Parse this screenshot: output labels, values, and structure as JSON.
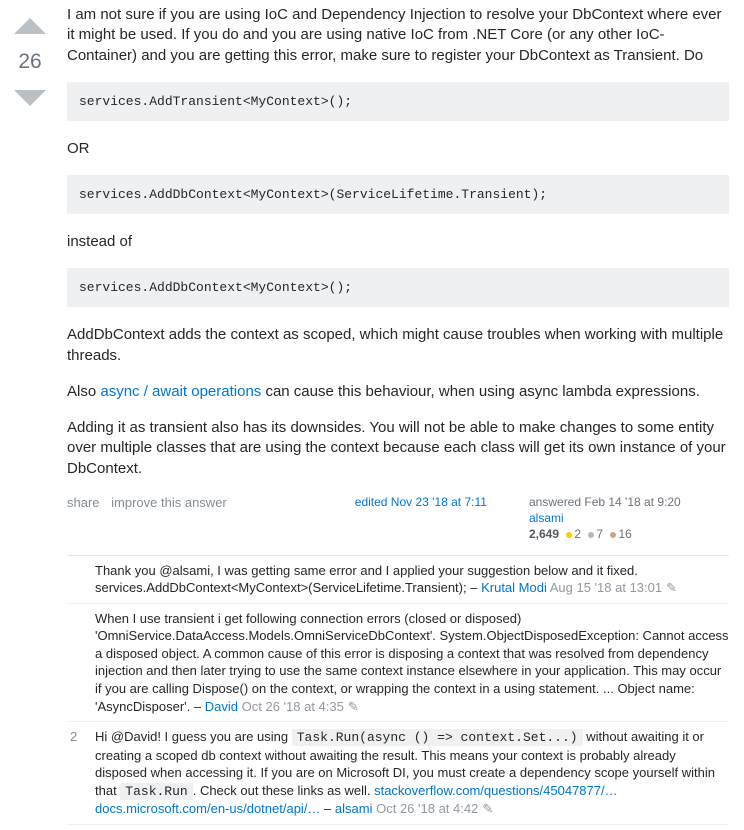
{
  "vote": {
    "score": "26"
  },
  "post": {
    "intro": "I am not sure if you are using IoC and Dependency Injection to resolve your DbContext where ever it might be used. If you do and you are using native IoC from .NET Core (or any other IoC-Container) and you are getting this error, make sure to register your DbContext as Transient. Do",
    "code1": "services.AddTransient<MyContext>();",
    "or": "OR",
    "code2": "services.AddDbContext<MyContext>(ServiceLifetime.Transient);",
    "instead": "instead of",
    "code3": "services.AddDbContext<MyContext>();",
    "para2": "AddDbContext adds the context as scoped, which might cause troubles when working with multiple threads.",
    "para3_a": "Also ",
    "para3_link": "async / await operations",
    "para3_b": " can cause this behaviour, when using async lambda expressions.",
    "para4": "Adding it as transient also has its downsides. You will not be able to make changes to some entity over multiple classes that are using the context because each class will get its own instance of your DbContext."
  },
  "menu": {
    "share": "share",
    "improve": "improve this answer"
  },
  "edited": {
    "label": "edited Nov 23 '18 at 7:11"
  },
  "author": {
    "action": "answered Feb 14 '18 at 9:20",
    "name": "alsami",
    "rep": "2,649",
    "gold": "2",
    "silver": "7",
    "bronze": "16"
  },
  "comments": [
    {
      "score": "",
      "text": "Thank you @alsami, I was getting same error and I applied your suggestion below and it fixed. services.AddDbContext<MyContext>(ServiceLifetime.Transient);",
      "sep": " – ",
      "user": "Krutal Modi",
      "date": "Aug 15 '18 at 13:01",
      "edited": true
    },
    {
      "score": "",
      "text": "When I use transient i get following connection errors (closed or disposed) 'OmniService.DataAccess.Models.OmniServiceDbContext'. System.ObjectDisposedException: Cannot access a disposed object. A common cause of this error is disposing a context that was resolved from dependency injection and then later trying to use the same context instance elsewhere in your application. This may occur if you are calling Dispose() on the context, or wrapping the context in a using statement. ... Object name: 'AsyncDisposer'.",
      "sep": " – ",
      "user": "David",
      "date": "Oct 26 '18 at 4:35",
      "edited": true
    },
    {
      "score": "2",
      "pre": "Hi @David! I guess you are using ",
      "code1": "Task.Run(async () => context.Set...)",
      "mid": " without awaiting it or creating a scoped db context without awaiting the result. This means your context is probably already disposed when accessing it. If you are on Microsoft DI, you must create a dependency scope yourself within that ",
      "code2": "Task.Run",
      "post": ". Check out these links as well. ",
      "link1": "stackoverflow.com/questions/45047877/…",
      "link2": "docs.microsoft.com/en-us/dotnet/api/…",
      "sep": " – ",
      "user": "alsami",
      "date": "Oct 26 '18 at 4:42",
      "edited": true
    }
  ]
}
